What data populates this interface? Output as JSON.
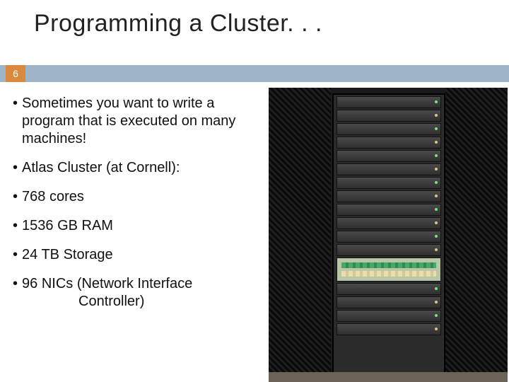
{
  "title": "Programming a Cluster. . .",
  "page_number": "6",
  "bullets": [
    {
      "text": "Sometimes you want to write a program that is executed on many machines!",
      "indent": false
    },
    {
      "text": "Atlas Cluster (at Cornell):",
      "indent": false
    },
    {
      "text": "768 cores",
      "indent": false
    },
    {
      "text": "1536 GB RAM",
      "indent": false
    },
    {
      "text": "24 TB Storage",
      "indent": false
    },
    {
      "text": "96 NICs (Network Interface",
      "indent": false,
      "continuation": "Controller)"
    }
  ],
  "image_alt": "server-rack-photo"
}
